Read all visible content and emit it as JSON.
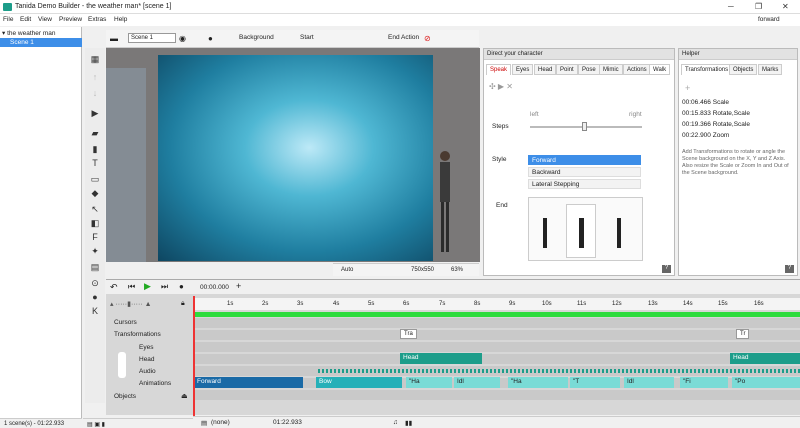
{
  "window": {
    "title": "Tanida Demo Builder - the weather man* [scene 1]",
    "right_label": "forward"
  },
  "menu": [
    "File",
    "Edit",
    "View",
    "Preview",
    "Extras",
    "Help"
  ],
  "tree": {
    "root": "the weather man",
    "scene": "Scene 1"
  },
  "statusbar": {
    "scenes": "1 scene(s) - 01:22.933",
    "none": "(none)",
    "duration": "01:22.933"
  },
  "toolbar": {
    "scene_field": "Scene 1",
    "background": "Background",
    "start": "Start",
    "end_action": "End Action"
  },
  "stagebar": {
    "mode": "Auto",
    "size": "750x550",
    "zoom": "63%"
  },
  "direct": {
    "title": "Direct your character",
    "tabs": [
      "Speak",
      "Eyes",
      "Head",
      "Point",
      "Pose",
      "Mimic",
      "Actions",
      "Walk"
    ],
    "active_tab": "Walk",
    "steps_label": "Steps",
    "left_label": "left",
    "right_label": "right",
    "style_label": "Style",
    "styles": [
      "Forward",
      "Backward",
      "Lateral Stepping"
    ],
    "selected_style": "Forward",
    "end_label": "End"
  },
  "helper": {
    "title": "Helper",
    "tabs": [
      "Transformations",
      "Objects",
      "Marks"
    ],
    "rows": [
      {
        "time": "00:06.466",
        "text": "Scale"
      },
      {
        "time": "00:15.833",
        "text": "Rotate,Scale"
      },
      {
        "time": "00:19.366",
        "text": "Rotate,Scale"
      },
      {
        "time": "00:22.900",
        "text": "Zoom"
      }
    ],
    "hint": "Add Transformations to rotate or angle the Scene background on the X, Y and Z Axis. Also resize the Scale or Zoom In and Out of the Scene background."
  },
  "timeline": {
    "time": "00:00.000",
    "ruler": [
      "1s",
      "2s",
      "3s",
      "4s",
      "5s",
      "6s",
      "7s",
      "8s",
      "9s",
      "10s",
      "11s",
      "12s",
      "13s",
      "14s",
      "15s",
      "16s"
    ],
    "tracks": [
      "Cursors",
      "Transformations",
      "Eyes",
      "Head",
      "Audio",
      "Animations",
      "Objects"
    ],
    "tags": [
      "Tra",
      "Tr"
    ],
    "head_clips": [
      "Head",
      "Head"
    ],
    "anim_clips": [
      "Forward",
      "Bow",
      "\"Ha",
      "Idl",
      "\"Ha",
      "\"T",
      "Idl",
      "\"Fi",
      "\"Po"
    ]
  },
  "colors": {
    "accent": "#2ddc3d",
    "head": "#1d9d8a",
    "select": "#3d8ee8"
  }
}
